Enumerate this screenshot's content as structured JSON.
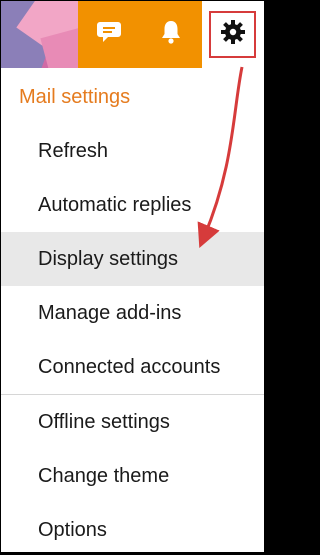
{
  "topbar": {
    "icons": [
      "chat-icon",
      "bell-icon",
      "gear-icon"
    ],
    "accent": "#f29100"
  },
  "menu": {
    "header": "Mail settings",
    "group1": [
      {
        "label": "Refresh"
      },
      {
        "label": "Automatic replies"
      },
      {
        "label": "Display settings",
        "selected": true
      },
      {
        "label": "Manage add-ins"
      },
      {
        "label": "Connected accounts"
      }
    ],
    "group2": [
      {
        "label": "Offline settings"
      },
      {
        "label": "Change theme"
      },
      {
        "label": "Options"
      }
    ]
  },
  "colors": {
    "header_text": "#e57b1e",
    "highlight_red": "#d63b3b",
    "selected_bg": "#e8e8e8"
  }
}
